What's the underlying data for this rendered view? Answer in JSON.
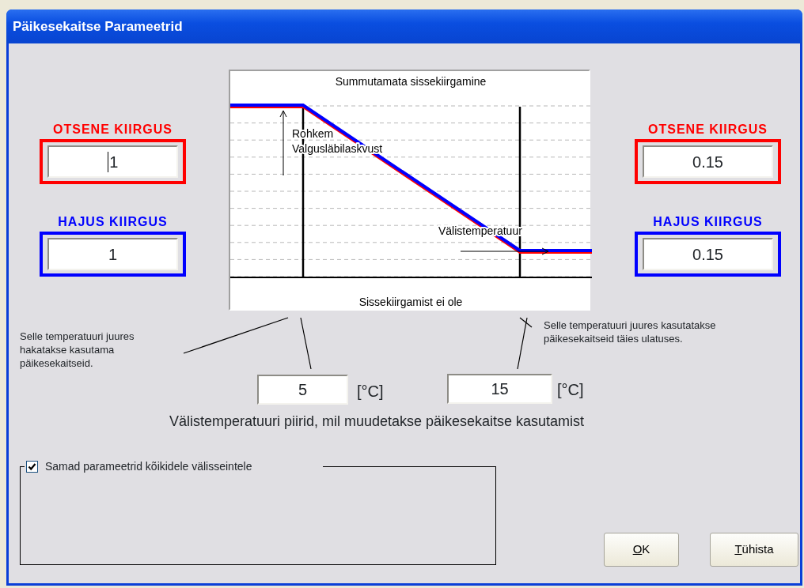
{
  "window": {
    "title": "Päikesekaitse Parameetrid"
  },
  "left_panel": [
    {
      "kind": "direct",
      "label": "OTSENE KIIRGUS",
      "value": "1",
      "focused": true
    },
    {
      "kind": "diffuse",
      "label": "HAJUS KIIRGUS",
      "value": "1",
      "focused": false
    }
  ],
  "diagram": {
    "top_label": "Summutamata sissekiirgamine",
    "arrow_label_lines": [
      "Rohkem",
      "Valgusläbilaskvust"
    ],
    "axis_label": "Välistemperatuur",
    "bottom_label": "Sissekiirgamist ei ole"
  },
  "right_panel": [
    {
      "kind": "direct",
      "label": "OTSENE KIIRGUS",
      "value": "0.15",
      "focused": false
    },
    {
      "kind": "diffuse",
      "label": "HAJUS KIIRGUS",
      "value": "0.15",
      "focused": false
    }
  ],
  "limits": {
    "start_note": "Selle temperatuuri juures hakatakse kasutama päikesekaitseid.",
    "full_note": "Selle temperatuuri juures kasutatakse päikesekaitseid täies ulatuses.",
    "start_value": "5",
    "start_unit": "[°C]",
    "full_value": "15",
    "full_unit": "[°C]",
    "caption": "Välistemperatuuri piirid, mil muudetakse päikesekaitse kasutamist"
  },
  "group": {
    "label": "Samad parameetrid kõikidele välisseintele",
    "checked": true
  },
  "buttons": [
    {
      "label": "OK"
    },
    {
      "label": "Tühista"
    }
  ]
}
